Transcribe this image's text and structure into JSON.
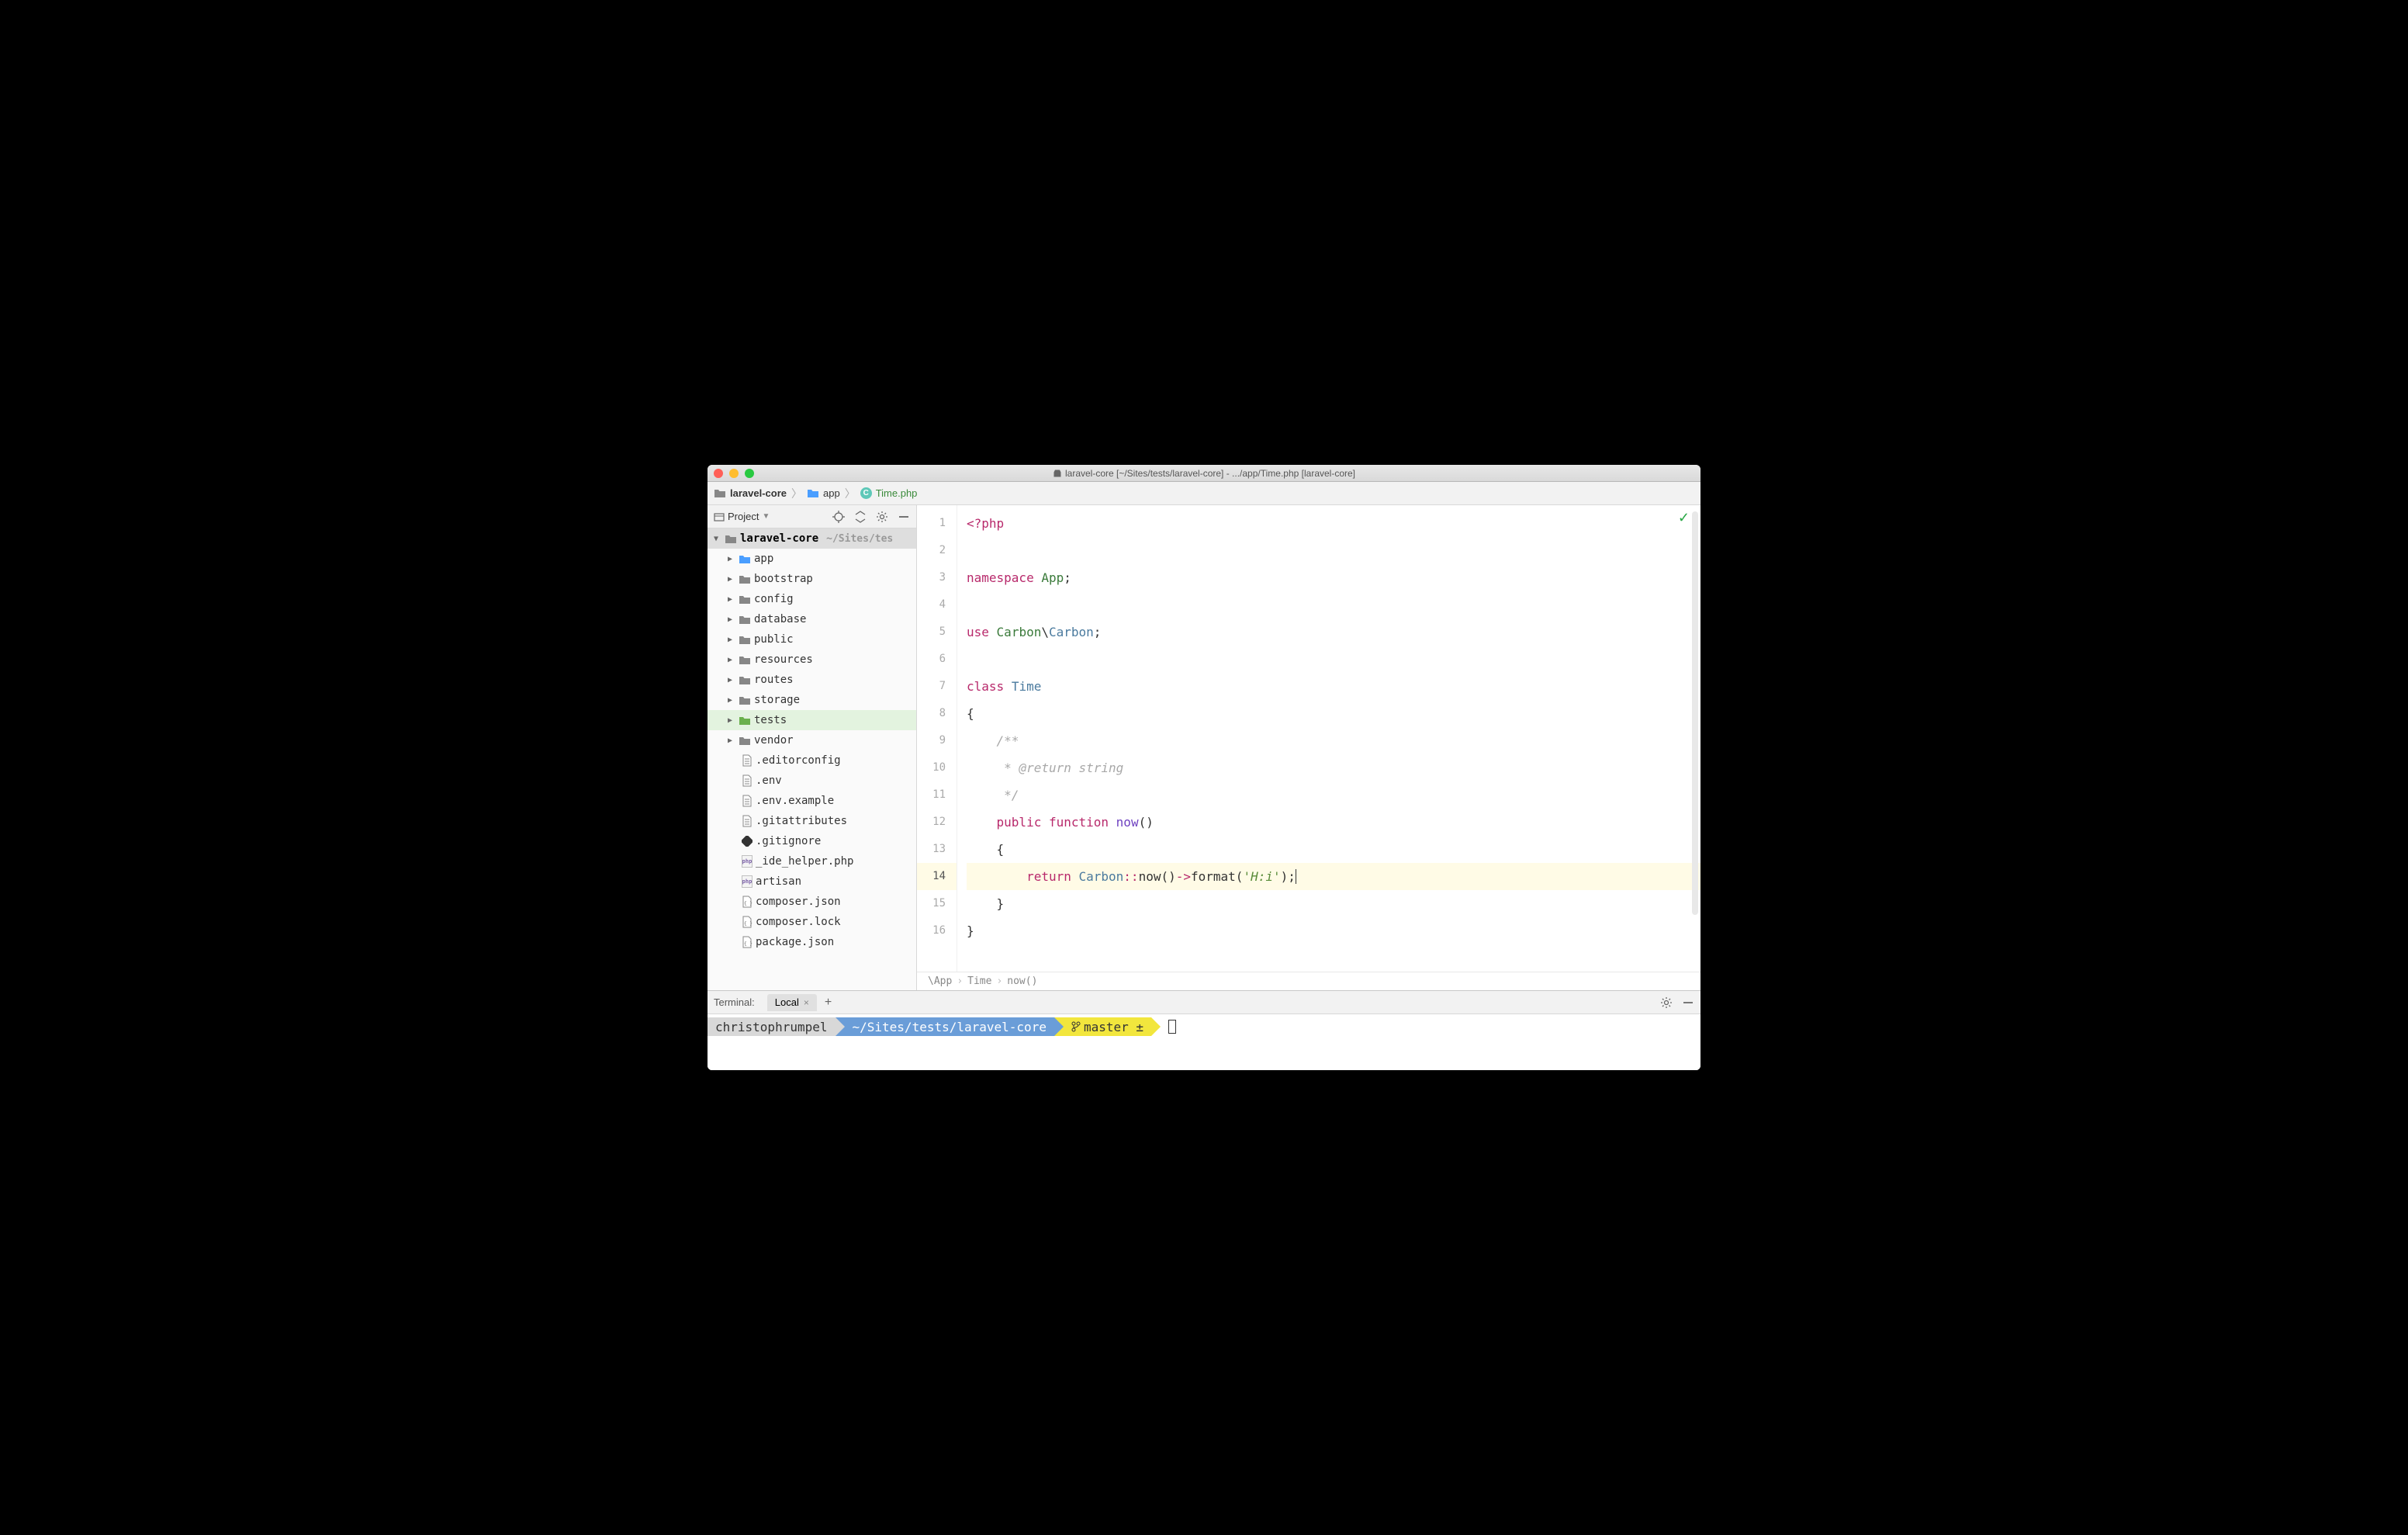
{
  "window_title": "laravel-core [~/Sites/tests/laravel-core] - .../app/Time.php [laravel-core]",
  "breadcrumb": {
    "items": [
      {
        "label": "laravel-core",
        "kind": "project"
      },
      {
        "label": "app",
        "kind": "folder"
      },
      {
        "label": "Time.php",
        "kind": "class"
      }
    ]
  },
  "sidebar": {
    "project_label": "Project",
    "root": {
      "label": "laravel-core",
      "path": "~/Sites/tes"
    },
    "folders": [
      {
        "label": "app",
        "blue": true
      },
      {
        "label": "bootstrap",
        "blue": false
      },
      {
        "label": "config",
        "blue": false
      },
      {
        "label": "database",
        "blue": false
      },
      {
        "label": "public",
        "blue": false
      },
      {
        "label": "resources",
        "blue": false
      },
      {
        "label": "routes",
        "blue": false
      },
      {
        "label": "storage",
        "blue": false
      },
      {
        "label": "tests",
        "blue": false,
        "selected": true,
        "green": true
      },
      {
        "label": "vendor",
        "blue": false
      }
    ],
    "files": [
      {
        "label": ".editorconfig",
        "kind": "text"
      },
      {
        "label": ".env",
        "kind": "text"
      },
      {
        "label": ".env.example",
        "kind": "text"
      },
      {
        "label": ".gitattributes",
        "kind": "text"
      },
      {
        "label": ".gitignore",
        "kind": "git"
      },
      {
        "label": "_ide_helper.php",
        "kind": "php"
      },
      {
        "label": "artisan",
        "kind": "php"
      },
      {
        "label": "composer.json",
        "kind": "json"
      },
      {
        "label": "composer.lock",
        "kind": "json"
      },
      {
        "label": "package.json",
        "kind": "json"
      }
    ]
  },
  "editor": {
    "lines": [
      1,
      2,
      3,
      4,
      5,
      6,
      7,
      8,
      9,
      10,
      11,
      12,
      13,
      14,
      15,
      16
    ],
    "current_line": 14,
    "code_breadcrumb": [
      "\\App",
      "Time",
      "now()"
    ]
  },
  "code": {
    "l1_open": "<?php",
    "l3_ns": "namespace",
    "l3_app": "App",
    "l5_use": "use",
    "l5_carbon1": "Carbon",
    "l5_carbon2": "Carbon",
    "l7_class": "class",
    "l7_name": "Time",
    "l9_doc1": "/**",
    "l10_doc": " * @return string",
    "l11_doc": " */",
    "l12_public": "public",
    "l12_function": "function",
    "l12_name": "now",
    "l14_return": "return",
    "l14_carbon": "Carbon",
    "l14_now": "now",
    "l14_format": "format",
    "l14_string": "'H:i'"
  },
  "terminal": {
    "label": "Terminal:",
    "tab": "Local",
    "user": "christophrumpel",
    "path": "~/Sites/tests/laravel-core",
    "branch": "master",
    "dirty": "±"
  }
}
